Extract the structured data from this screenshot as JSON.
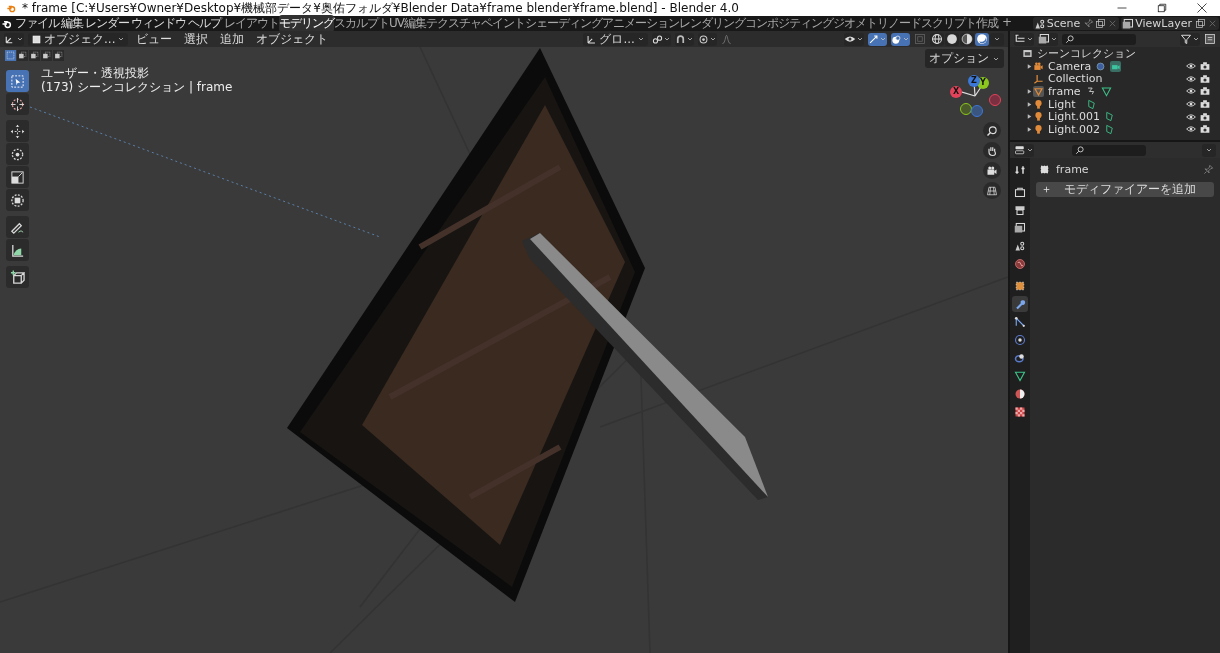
{
  "window": {
    "title": "* frame [C:¥Users¥Owner¥Desktop¥機械部データ¥奥佑フォルダ¥Blender Data¥frame blender¥frame.blend] - Blender 4.0"
  },
  "menus": [
    "ファイル",
    "編集",
    "レンダー",
    "ウィンドウ",
    "ヘルプ"
  ],
  "workspaces": [
    {
      "label": "レイアウト",
      "selected": false
    },
    {
      "label": "モデリング",
      "selected": true
    },
    {
      "label": "スカルプト",
      "selected": false
    },
    {
      "label": "UV編集",
      "selected": false
    },
    {
      "label": "テクスチャペイント",
      "selected": false
    },
    {
      "label": "シェーディング",
      "selected": false
    },
    {
      "label": "アニメーション",
      "selected": false
    },
    {
      "label": "レンダリング",
      "selected": false
    },
    {
      "label": "コンポジティング",
      "selected": false
    },
    {
      "label": "ジオメトリノード",
      "selected": false
    },
    {
      "label": "スクリプト作成",
      "selected": false
    }
  ],
  "add_workspace": "+",
  "scene": "Scene",
  "view_layer": "ViewLayer",
  "viewport": {
    "mode": "オブジェク...",
    "menus": [
      "ビュー",
      "選択",
      "追加",
      "オブジェクト"
    ],
    "orientation": "グロ...",
    "options": "オプション",
    "view_name": "ユーザー・透視投影",
    "collection_info": "(173) シーンコレクション | frame",
    "tools": [
      {
        "kind": "select",
        "selected": true
      },
      {
        "kind": "cursor",
        "selected": false
      },
      {
        "kind": "move",
        "selected": false
      },
      {
        "kind": "rotate",
        "selected": false
      },
      {
        "kind": "scale",
        "selected": false
      },
      {
        "kind": "transform",
        "selected": false
      },
      {
        "kind": "annotate",
        "selected": false
      },
      {
        "kind": "measure",
        "selected": false
      },
      {
        "kind": "add_cube",
        "selected": false
      }
    ],
    "shading": [
      {
        "kind": "wireframe",
        "selected": false
      },
      {
        "kind": "solid",
        "selected": false
      },
      {
        "kind": "material",
        "selected": false
      },
      {
        "kind": "rendered",
        "selected": true
      }
    ],
    "axes": [
      "X",
      "Y",
      "Z"
    ]
  },
  "outliner": {
    "root": "シーンコレクション",
    "items": [
      {
        "name": "Camera",
        "kind": "camera",
        "visible": true
      },
      {
        "name": "Collection",
        "kind": "collection",
        "visible": true
      },
      {
        "name": "frame",
        "kind": "mesh",
        "visible": true
      },
      {
        "name": "Light",
        "kind": "light",
        "visible": true
      },
      {
        "name": "Light.001",
        "kind": "light",
        "visible": true
      },
      {
        "name": "Light.002",
        "kind": "light",
        "visible": true
      }
    ]
  },
  "properties": {
    "object_name": "frame",
    "add_modifier": "モディファイアーを追加",
    "tabs": [
      {
        "kind": "tool",
        "selected": false
      },
      {
        "kind": "render",
        "selected": false
      },
      {
        "kind": "output",
        "selected": false
      },
      {
        "kind": "view_layer",
        "selected": false
      },
      {
        "kind": "scene",
        "selected": false
      },
      {
        "kind": "world",
        "selected": false
      },
      {
        "kind": "object",
        "selected": false
      },
      {
        "kind": "modifier",
        "selected": true
      },
      {
        "kind": "particles",
        "selected": false
      },
      {
        "kind": "physics",
        "selected": false
      },
      {
        "kind": "constraints",
        "selected": false
      },
      {
        "kind": "data",
        "selected": false
      },
      {
        "kind": "material",
        "selected": false
      },
      {
        "kind": "texture",
        "selected": false
      }
    ]
  }
}
